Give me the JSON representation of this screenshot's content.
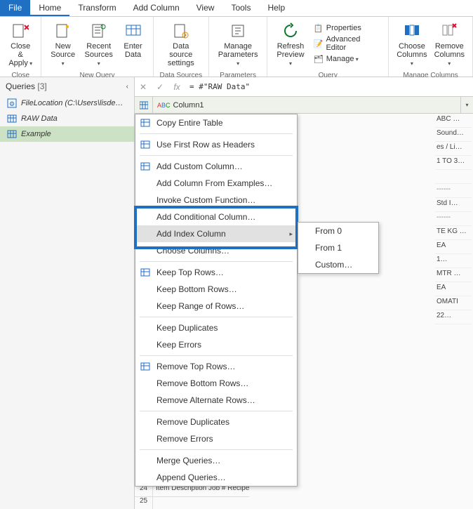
{
  "menubar": {
    "file": "File",
    "tabs": [
      "Home",
      "Transform",
      "Add Column",
      "View",
      "Tools",
      "Help"
    ],
    "active": 0
  },
  "ribbon": {
    "groups": [
      {
        "label": "Close",
        "buttons": [
          {
            "label": "Close &\nApply",
            "drop": true,
            "icon": "close-apply"
          }
        ]
      },
      {
        "label": "New Query",
        "buttons": [
          {
            "label": "New\nSource",
            "drop": true,
            "icon": "new-source"
          },
          {
            "label": "Recent\nSources",
            "drop": true,
            "icon": "recent"
          },
          {
            "label": "Enter\nData",
            "drop": false,
            "icon": "enter-data"
          }
        ]
      },
      {
        "label": "Data Sources",
        "buttons": [
          {
            "label": "Data source\nsettings",
            "drop": false,
            "icon": "settings"
          }
        ]
      },
      {
        "label": "Parameters",
        "buttons": [
          {
            "label": "Manage\nParameters",
            "drop": true,
            "icon": "params"
          }
        ]
      },
      {
        "label": "Query",
        "buttons": [
          {
            "label": "Refresh\nPreview",
            "drop": true,
            "icon": "refresh"
          }
        ],
        "small": [
          {
            "label": "Properties",
            "icon": "props"
          },
          {
            "label": "Advanced Editor",
            "icon": "adv"
          },
          {
            "label": "Manage",
            "drop": true,
            "icon": "manage"
          }
        ]
      },
      {
        "label": "Manage Columns",
        "buttons": [
          {
            "label": "Choose\nColumns",
            "drop": true,
            "icon": "choose-cols"
          },
          {
            "label": "Remove\nColumns",
            "drop": true,
            "icon": "remove-cols"
          }
        ]
      }
    ]
  },
  "sidebar": {
    "title": "Queries",
    "count": "[3]",
    "items": [
      {
        "label": "FileLocation (C:\\Users\\lisde…",
        "kind": "param"
      },
      {
        "label": "RAW Data",
        "kind": "table"
      },
      {
        "label": "Example",
        "kind": "table",
        "selected": true
      }
    ]
  },
  "formula": {
    "symbols": {
      "cancel": "✕",
      "commit": "✓",
      "fx": "fx"
    },
    "value": "= #\"RAW Data\""
  },
  "grid": {
    "column1_label": "Column1",
    "column1_type": "ABC",
    "right_strip": [
      "ABC …",
      "Sound…",
      "es / Li…",
      "1 TO 3…",
      "",
      "------",
      "Std I…",
      "------",
      "TE KG …",
      "EA",
      "1…",
      "MTR …",
      "EA",
      "OMATI",
      "22…"
    ],
    "rows": [
      {
        "n": "24",
        "t": "Item     Description        Job #   Recipe"
      },
      {
        "n": "25",
        "t": ""
      }
    ]
  },
  "context_menu": {
    "groups": [
      [
        {
          "label": "Copy Entire Table",
          "icon": "copy"
        }
      ],
      [
        {
          "label": "Use First Row as Headers",
          "icon": "headers"
        }
      ],
      [
        {
          "label": "Add Custom Column…",
          "icon": "addcol"
        },
        {
          "label": "Add Column From Examples…"
        },
        {
          "label": "Invoke Custom Function…"
        },
        {
          "label": "Add Conditional Column…"
        },
        {
          "label": "Add Index Column",
          "hover": true,
          "submenu": true
        },
        {
          "label": "Choose Columns…"
        }
      ],
      [
        {
          "label": "Keep Top Rows…",
          "icon": "keep"
        },
        {
          "label": "Keep Bottom Rows…"
        },
        {
          "label": "Keep Range of Rows…"
        }
      ],
      [
        {
          "label": "Keep Duplicates"
        },
        {
          "label": "Keep Errors"
        }
      ],
      [
        {
          "label": "Remove Top Rows…",
          "icon": "remove"
        },
        {
          "label": "Remove Bottom Rows…"
        },
        {
          "label": "Remove Alternate Rows…"
        }
      ],
      [
        {
          "label": "Remove Duplicates"
        },
        {
          "label": "Remove Errors"
        }
      ],
      [
        {
          "label": "Merge Queries…"
        },
        {
          "label": "Append Queries…"
        }
      ]
    ]
  },
  "submenu": {
    "items": [
      "From 0",
      "From 1",
      "Custom…"
    ]
  }
}
